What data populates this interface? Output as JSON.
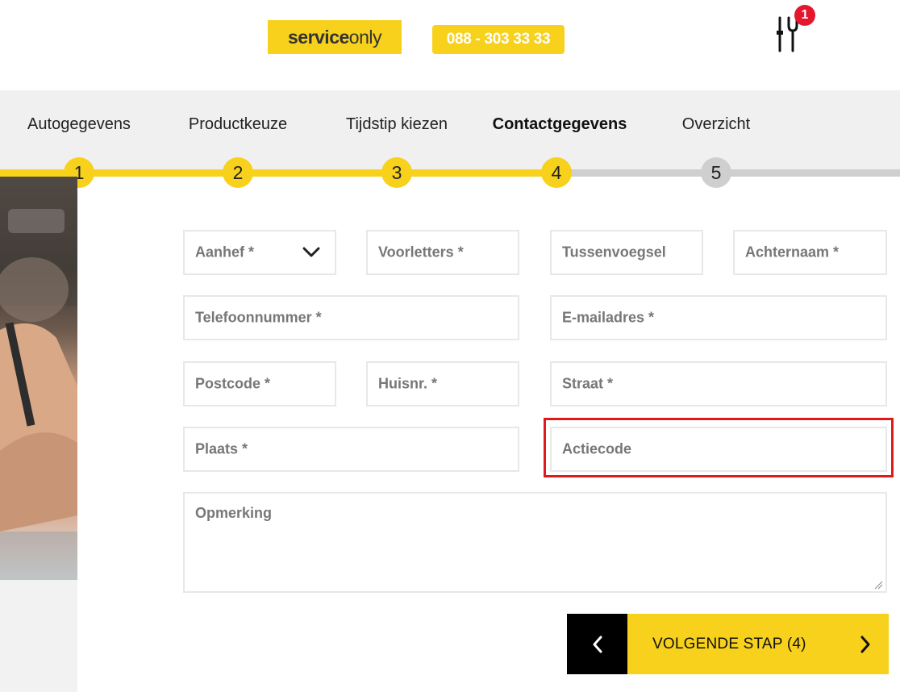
{
  "header": {
    "logo_part1": "service",
    "logo_part2": "only",
    "phone": "088 - 303 33 33",
    "cart_count": "1"
  },
  "steps": [
    {
      "number": "1",
      "label": "Autogegevens",
      "state": "done"
    },
    {
      "number": "2",
      "label": "Productkeuze",
      "state": "done"
    },
    {
      "number": "3",
      "label": "Tijdstip kiezen",
      "state": "done"
    },
    {
      "number": "4",
      "label": "Contactgegevens",
      "state": "active"
    },
    {
      "number": "5",
      "label": "Overzicht",
      "state": "todo"
    }
  ],
  "form": {
    "aanhef": "Aanhef *",
    "voorletters": "Voorletters *",
    "tussenvoegsel": "Tussenvoegsel",
    "achternaam": "Achternaam *",
    "telefoonnummer": "Telefoonnummer *",
    "email": "E-mailadres *",
    "postcode": "Postcode *",
    "huisnr": "Huisnr. *",
    "straat": "Straat *",
    "plaats": "Plaats *",
    "actiecode": "Actiecode",
    "opmerking": "Opmerking"
  },
  "buttons": {
    "next_label": "VOLGENDE STAP (4)"
  },
  "colors": {
    "accent": "#f7d11b",
    "badge": "#e3172d",
    "highlight": "#e01a1a",
    "inactive": "#cfcfcf"
  }
}
